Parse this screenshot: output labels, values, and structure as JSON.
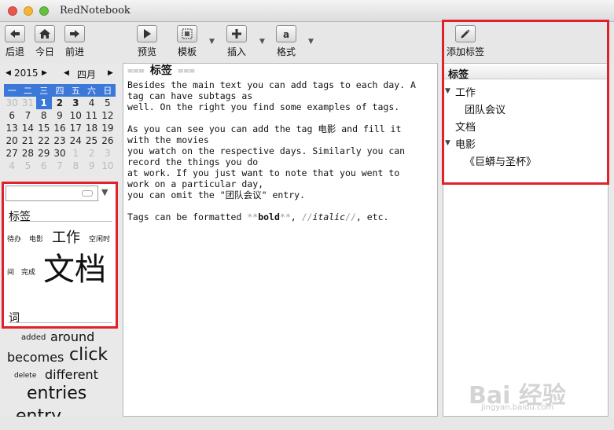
{
  "window": {
    "title": "RedNotebook"
  },
  "toolbar": {
    "back": "后退",
    "today": "今日",
    "forward": "前进",
    "preview": "预览",
    "template": "模板",
    "insert": "插入",
    "format": "格式",
    "add_tag": "添加标签"
  },
  "calendar": {
    "prev_year": "◀",
    "year": "2015",
    "next_year": "▶",
    "prev_month": "◀",
    "month": "四月",
    "next_month": "▶",
    "weekdays": [
      "一",
      "二",
      "三",
      "四",
      "五",
      "六",
      "日"
    ],
    "rows": [
      [
        "30",
        "31",
        "1",
        "2",
        "3",
        "4",
        "5"
      ],
      [
        "6",
        "7",
        "8",
        "9",
        "10",
        "11",
        "12"
      ],
      [
        "13",
        "14",
        "15",
        "16",
        "17",
        "18",
        "19"
      ],
      [
        "20",
        "21",
        "22",
        "23",
        "24",
        "25",
        "26"
      ],
      [
        "27",
        "28",
        "29",
        "30",
        "1",
        "2",
        "3"
      ],
      [
        "4",
        "5",
        "6",
        "7",
        "8",
        "9",
        "10"
      ]
    ]
  },
  "search": {
    "value": "",
    "dropdown": "▼"
  },
  "cloud": {
    "tags_title": "标签",
    "tags": [
      "待办",
      "电影",
      "工作",
      "空闲时",
      "间",
      "完成",
      "文档"
    ],
    "words_title": "词",
    "words": [
      "added",
      "around",
      "becomes",
      "click",
      "delete",
      "different",
      "entries",
      "entry"
    ]
  },
  "editor": {
    "heading_open": "===",
    "heading_text": "标签",
    "heading_close": "===",
    "lines": [
      "Besides the main text you can add tags to each day. A",
      "tag can have subtags as",
      "well. On the right you find some examples of tags.",
      "",
      "As you can see you can add the tag 电影 and fill it",
      "with the movies",
      "you watch on the respective days. Similarly you can",
      "record the things you do",
      "at work. If you just want to note that you went to",
      "work on a particular day,",
      "you can omit the \"团队会议\" entry.",
      ""
    ],
    "format_line": {
      "prefix": "Tags can be formatted ",
      "bold_mark_open": "**",
      "bold": "bold",
      "bold_mark_close": "**",
      "sep": ", ",
      "italic_mark_open": "//",
      "italic": "italic",
      "italic_mark_close": "//",
      "suffix": ", etc."
    }
  },
  "tag_panel": {
    "header": "标签",
    "items": [
      {
        "label": "工作",
        "expander": "▼"
      },
      {
        "label": "团队会议"
      },
      {
        "label": "文档"
      },
      {
        "label": "电影",
        "expander": "▼"
      },
      {
        "label": "《巨蟒与圣杯》"
      }
    ]
  },
  "watermark": {
    "logo": "Bai 经验",
    "url": "jingyan.baidu.com"
  }
}
